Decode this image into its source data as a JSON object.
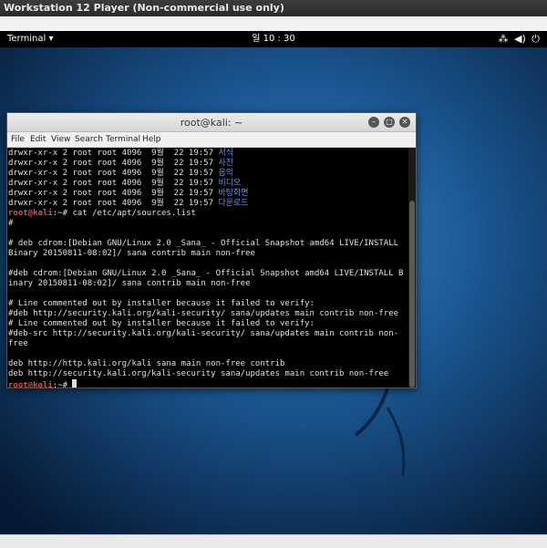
{
  "host_window": {
    "title": "Workstation 12 Player (Non-commercial use only)"
  },
  "gnome_panel": {
    "app_menu": "Terminal",
    "app_menu_caret": "▾",
    "clock": "일 10 : 30",
    "tray_icons": [
      "network-icon",
      "volume-icon",
      "power-icon"
    ],
    "tray_glyphs": [
      "⁂",
      "◀)",
      "⏻"
    ]
  },
  "terminal": {
    "title": "root@kali: ~",
    "window_buttons": [
      "–",
      "▢",
      "✕"
    ],
    "menu": [
      "File",
      "Edit",
      "View",
      "Search",
      "Terminal",
      "Help"
    ],
    "lines": [
      {
        "prefix": "drwxr-xr-x 2 root root 4096  9월  22 19:57 ",
        "dir": "서식"
      },
      {
        "prefix": "drwxr-xr-x 2 root root 4096  9월  22 19:57 ",
        "dir": "사진"
      },
      {
        "prefix": "drwxr-xr-x 2 root root 4096  9월  22 19:57 ",
        "dir": "음악"
      },
      {
        "prefix": "drwxr-xr-x 2 root root 4096  9월  22 19:57 ",
        "dir": "비디오"
      },
      {
        "prefix": "drwxr-xr-x 2 root root 4096  9월  22 19:57 ",
        "dir": "바탕화면"
      },
      {
        "prefix": "drwxr-xr-x 2 root root 4096  9월  22 19:57 ",
        "dir": "다운로드"
      },
      {
        "prompt": "root@kali",
        "cmd": ":~# cat /etc/apt/sources.list"
      },
      {
        "text": "#"
      },
      {
        "text": ""
      },
      {
        "text": "# deb cdrom:[Debian GNU/Linux 2.0 _Sana_ - Official Snapshot amd64 LIVE/INSTALL"
      },
      {
        "text": "Binary 20150811-08:02]/ sana contrib main non-free"
      },
      {
        "text": ""
      },
      {
        "text": "#deb cdrom:[Debian GNU/Linux 2.0 _Sana_ - Official Snapshot amd64 LIVE/INSTALL B"
      },
      {
        "text": "inary 20150811-08:02]/ sana contrib main non-free"
      },
      {
        "text": ""
      },
      {
        "text": "# Line commented out by installer because it failed to verify:"
      },
      {
        "text": "#deb http://security.kali.org/kali-security/ sana/updates main contrib non-free"
      },
      {
        "text": "# Line commented out by installer because it failed to verify:"
      },
      {
        "text": "#deb-src http://security.kali.org/kali-security/ sana/updates main contrib non-"
      },
      {
        "text": "free"
      },
      {
        "text": ""
      },
      {
        "text": "deb http://http.kali.org/kali sana main non-free contrib"
      },
      {
        "text": "deb http://security.kali.org/kali-security sana/updates main contrib non-free"
      },
      {
        "prompt": "root@kali",
        "cmd": ":~# ",
        "cursor": true
      }
    ]
  },
  "colors": {
    "prompt": "#e04a4a",
    "directory": "#6f8fd8",
    "wallpaper": "#0c2a4a"
  }
}
